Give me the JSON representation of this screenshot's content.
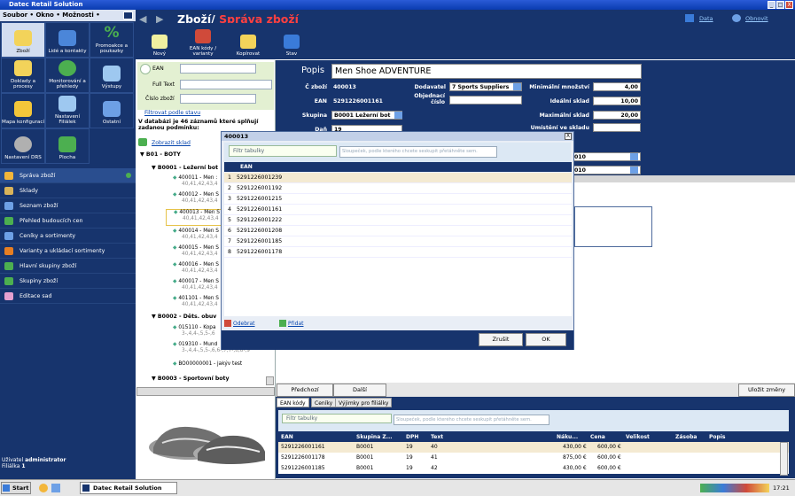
{
  "window": {
    "title": "Datec Retail Solution",
    "min": "_",
    "max": "□",
    "close": "X"
  },
  "menu": {
    "file": "Soubor",
    "sep1": "•",
    "window": "Okno",
    "sep2": "•",
    "options": "Možnosti",
    "arrow": "•"
  },
  "tiles": [
    {
      "label": "Zboží",
      "color": "#f3d35a"
    },
    {
      "label": "Lidé a kontakty",
      "color": "#4b86d9"
    },
    {
      "label": "Promoakce a poukazky",
      "color": "#4caf50",
      "glyph": "%"
    },
    {
      "label": "Doklady a procesy",
      "color": "#f3d35a"
    },
    {
      "label": "Monitorování a přehledy",
      "color": "#4caf50"
    },
    {
      "label": "Výstupy",
      "color": "#9ec8f0"
    },
    {
      "label": "Mapa konfigurací",
      "color": "#f3c63a"
    },
    {
      "label": "Nastavení Filiálek",
      "color": "#9ec8f0"
    },
    {
      "label": "Ostatní",
      "color": "#6da0e6"
    },
    {
      "label": "Nastavení DRS",
      "color": "#b0b0b0"
    },
    {
      "label": "Plocha",
      "color": "#4caf50"
    }
  ],
  "nav": [
    {
      "label": "Správa zboží",
      "color": "#f3b63a"
    },
    {
      "label": "Sklady",
      "color": "#d9b35a"
    },
    {
      "label": "Seznam zboží",
      "color": "#6da0e6"
    },
    {
      "label": "Přehled budoucích cen",
      "color": "#4caf50"
    },
    {
      "label": "Ceníky a sortimenty",
      "color": "#6da0e6"
    },
    {
      "label": "Varianty a ukládací sortimenty",
      "color": "#e67e22"
    },
    {
      "label": "Hlavní skupiny zboží",
      "color": "#4caf50"
    },
    {
      "label": "Skupiny zboží",
      "color": "#4caf50"
    },
    {
      "label": "Editace sad",
      "color": "#e6a0d0"
    }
  ],
  "user": {
    "label": "Uživatel",
    "name": "administrator",
    "branch_label": "Filiálka",
    "branch": "1"
  },
  "header": {
    "title1": "Zboží/",
    "title2": "Správa zboží",
    "data": "Data",
    "refresh": "Obnovit"
  },
  "toolbar": [
    {
      "label": "Nový",
      "color": "#f0f0a0"
    },
    {
      "label": "EAN kódy / varianty",
      "color": "#d04a3a"
    },
    {
      "label": "Kopírovat",
      "color": "#f3d35a"
    },
    {
      "label": "Stav",
      "color": "#3a7bd9"
    }
  ],
  "search": {
    "ean": "EAN",
    "fulltext": "Full Text",
    "code": "Číslo zboží",
    "filter_link": "Filtrovat podle stavu",
    "result": "V databázi je 46 záznamů které splňují zadanou podmínku:",
    "show": "Zobrazit sklad"
  },
  "tree": {
    "g1": "B01 - BOTY",
    "g1a": "B0001 - Ležerní bot",
    "items": [
      {
        "code": "400011 - Men :",
        "sub": "40,41,42,43,4"
      },
      {
        "code": "400012 - Men S",
        "sub": "40,41,42,43,4"
      },
      {
        "code": "400013 - Men S",
        "sub": "40,41,42,43,4"
      },
      {
        "code": "400014 - Men S",
        "sub": "40,41,42,43,4"
      },
      {
        "code": "400015 - Men S",
        "sub": "40,41,42,43,4"
      },
      {
        "code": "400016 - Men S",
        "sub": "40,41,42,43,4"
      },
      {
        "code": "400017 - Men S",
        "sub": "40,41,42,43,4"
      },
      {
        "code": "401101 - Men S",
        "sub": "40,41,42,43,4"
      }
    ],
    "g1b": "B0002 - Děts. obuv",
    "items2": [
      {
        "code": "015110 - Kopa",
        "sub": "3-,4,4-,5,5-,6"
      },
      {
        "code": "019310 - Mund",
        "sub": "3-,4,4-,5,5-,6,6-,7,7-,8,8-,9"
      },
      {
        "code": "BO00000001 - jakýv test",
        "sub": ""
      }
    ],
    "g1c": "B0003 - Sportovní boty"
  },
  "detail": {
    "popis_label": "Popis",
    "popis": "Men Shoe ADVENTURE",
    "czbozi_label": "Č zboží",
    "czbozi": "400013",
    "dodavatel_label": "Dodavatel",
    "dodavatel": "7 Sports Suppliers",
    "min_label": "Minimální množství",
    "min": "4,00",
    "ean_label": "EAN",
    "ean": "5291226001161",
    "obj_label": "Objednací číslo",
    "ideal_label": "Ideální sklad",
    "ideal": "10,00",
    "skupina_label": "Skupina",
    "skupina": "B0001 Ležerní bot",
    "max_label": "Maximální sklad",
    "max": "20,00",
    "dan_label": "Daň",
    "dan": "19",
    "umisteni_label": "Umístění ve skladu",
    "v1": "010",
    "v2": "010"
  },
  "dialog": {
    "title": "400013",
    "close": "X",
    "filter": "Filtr tabulky",
    "group_hint": "Sloupeček, podle kterého chcete seskupit přetáhněte sem.",
    "col": "EAN",
    "rows": [
      "5291226001239",
      "5291226001192",
      "5291226001215",
      "5291226001161",
      "5291226001222",
      "5291226001208",
      "5291226001185",
      "5291226001178"
    ],
    "nums": [
      "1",
      "2",
      "3",
      "4",
      "5",
      "6",
      "7",
      "8"
    ],
    "remove": "Odebrat",
    "add": "Přidat",
    "cancel": "Zrušit",
    "ok": "OK"
  },
  "nav_buttons": {
    "prev": "Předchozí",
    "next": "Další",
    "save": "Uložit změny"
  },
  "tabs": [
    "EAN kódy",
    "Ceníky",
    "Výjimky pro filiálky"
  ],
  "grid": {
    "filter": "Filtr tabulky",
    "group_hint": "Sloupeček, podle kterého chcete seskupit přetáhněte sem.",
    "cols": [
      "EAN",
      "Skupina Z...",
      "DPH",
      "Text",
      "Náku...",
      "Cena",
      "Velikost",
      "Zásoba",
      "Popis"
    ],
    "rows": [
      [
        "5291226001161",
        "B0001",
        "19",
        "40",
        "430,00 €",
        "600,00 €"
      ],
      [
        "5291226001178",
        "B0001",
        "19",
        "41",
        "875,00 €",
        "600,00 €"
      ],
      [
        "5291226001185",
        "B0001",
        "19",
        "42",
        "430,00 €",
        "600,00 €"
      ]
    ]
  },
  "taskbar": {
    "start": "Start",
    "app": "Datec Retail Solution",
    "time": "17:21"
  }
}
